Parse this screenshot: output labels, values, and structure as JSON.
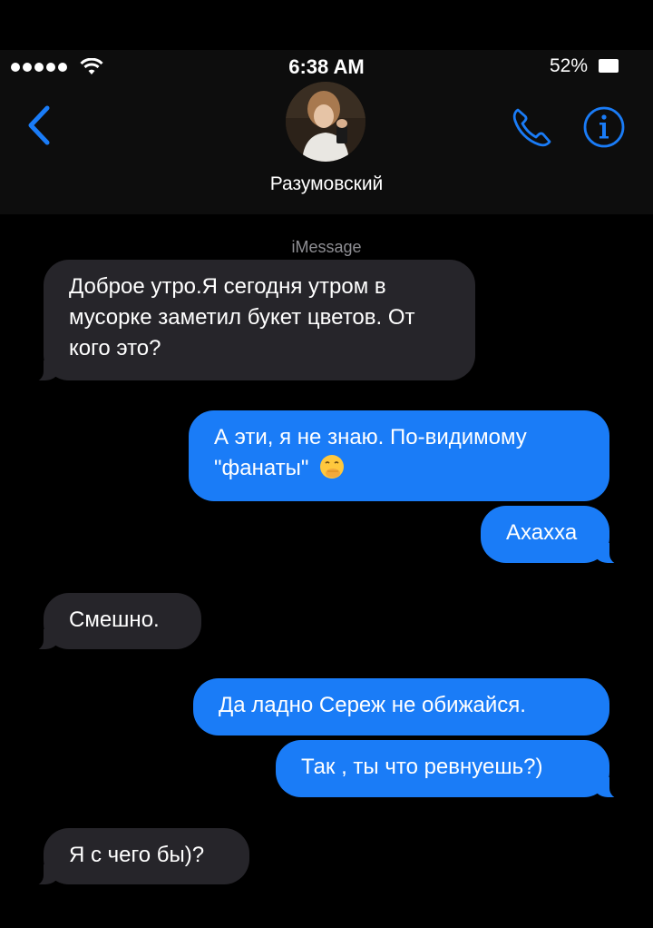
{
  "status_bar": {
    "time": "6:38 AM",
    "battery": "52%"
  },
  "header": {
    "contact_name": "Разумовский"
  },
  "conversation": {
    "service": "iMessage",
    "messages": [
      {
        "direction": "incoming",
        "text": "Доброе утро.Я сегодня утром в мусорке заметил букет цветов. От кого это?"
      },
      {
        "direction": "outgoing",
        "text": "А эти, я не знаю. По-видимому \"фанаты\"",
        "emoji": "face-with-hand-over-mouth"
      },
      {
        "direction": "outgoing",
        "text": "Ахахха"
      },
      {
        "direction": "incoming",
        "text": "Смешно."
      },
      {
        "direction": "outgoing",
        "text": "Да ладно Сереж не обижайся."
      },
      {
        "direction": "outgoing",
        "text": "Так , ты что ревнуешь?)"
      },
      {
        "direction": "incoming",
        "text": "Я с чего бы)?"
      }
    ]
  },
  "colors": {
    "accent": "#1a7cf7",
    "incoming_bubble": "#26252a",
    "header_bg": "#0d0d0d",
    "secondary_text": "#8e8e93"
  },
  "icons": {
    "back": "chevron-left-icon",
    "call": "phone-icon",
    "info": "info-icon",
    "wifi": "wifi-icon",
    "signal": "signal-dots-icon",
    "battery": "battery-icon"
  }
}
